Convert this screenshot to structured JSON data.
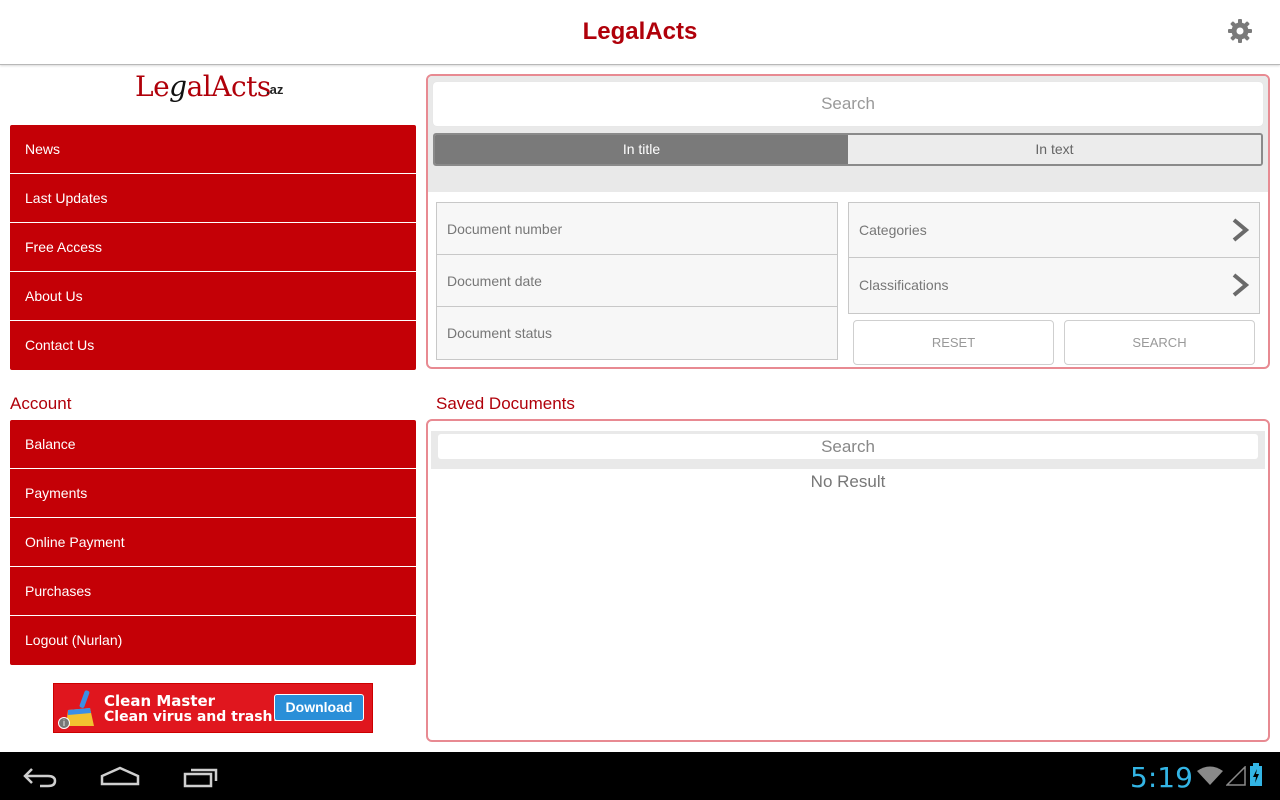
{
  "topbar": {
    "title": "LegalActs",
    "settings_icon": "gear-icon"
  },
  "logo": {
    "text_le": "Le",
    "text_g": "g",
    "text_alacts": "alActs",
    "text_az": ".az"
  },
  "main_menu": {
    "items": [
      {
        "label": "News"
      },
      {
        "label": "Last Updates"
      },
      {
        "label": "Free Access"
      },
      {
        "label": "About Us"
      },
      {
        "label": "Contact Us"
      }
    ]
  },
  "account": {
    "title": "Account",
    "items": [
      {
        "label": "Balance"
      },
      {
        "label": "Payments"
      },
      {
        "label": "Online Payment"
      },
      {
        "label": "Purchases"
      },
      {
        "label": "Logout (Nurlan)"
      }
    ]
  },
  "ad": {
    "line1": "Clean Master",
    "line2": "Clean virus and trash!",
    "button": "Download",
    "info": "i"
  },
  "search_panel": {
    "search_placeholder": "Search",
    "segments": [
      {
        "label": "In title",
        "selected": true
      },
      {
        "label": "In text",
        "selected": false
      }
    ],
    "left_fields": [
      {
        "label": "Document number"
      },
      {
        "label": "Document date"
      },
      {
        "label": "Document status"
      }
    ],
    "right_fields": [
      {
        "label": "Categories"
      },
      {
        "label": "Classifications"
      }
    ],
    "reset_label": "RESET",
    "search_label": "SEARCH"
  },
  "saved": {
    "title": "Saved Documents",
    "search_placeholder": "Search",
    "empty_text": "No Result"
  },
  "system_bar": {
    "time": "5:19",
    "icons": [
      "back-icon",
      "home-icon",
      "recent-apps-icon",
      "wifi-icon",
      "signal-icon",
      "battery-icon"
    ]
  },
  "colors": {
    "brand_red": "#c40006",
    "title_red": "#b0000a",
    "panel_border": "#e88a92",
    "clock_blue": "#33b5e5"
  }
}
